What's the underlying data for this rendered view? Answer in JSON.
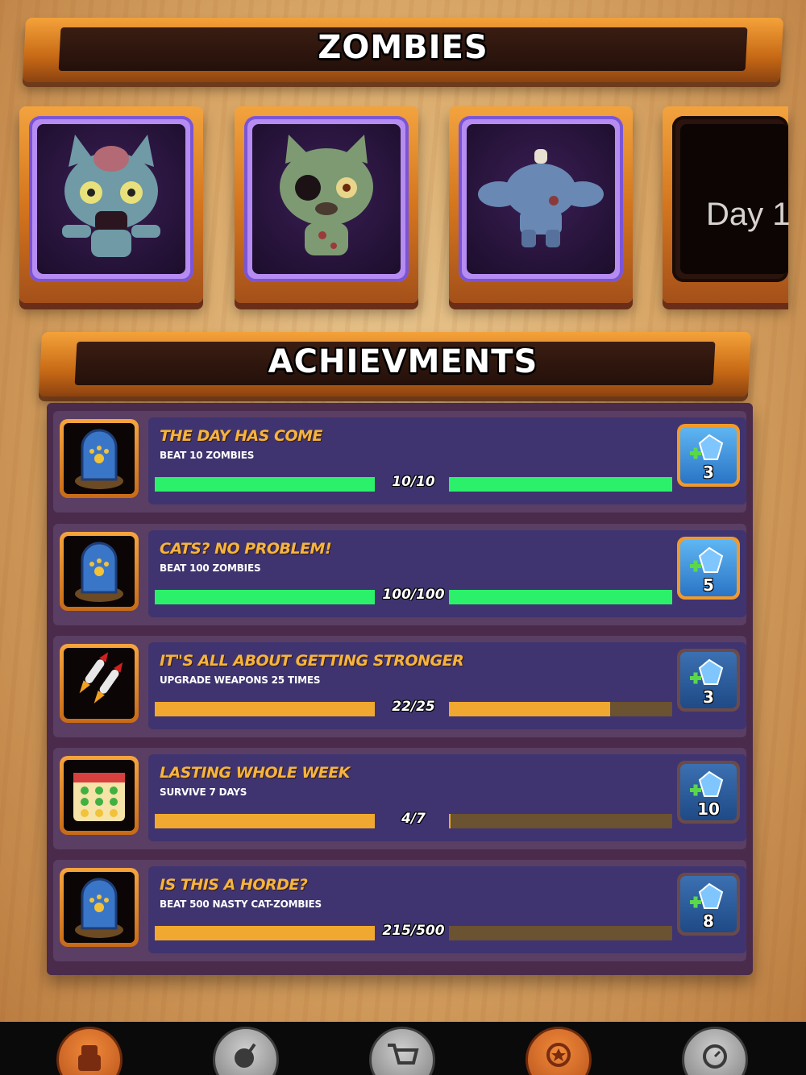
{
  "zombies_section": {
    "title": "ZOMBIES",
    "cards": [
      {
        "name": "zombie cat brain",
        "locked": false
      },
      {
        "name": "zombie cat one-eye",
        "locked": false
      },
      {
        "name": "zombie headless body",
        "locked": false
      },
      {
        "name": "locked card",
        "locked": true,
        "label": "Day 1"
      }
    ]
  },
  "achievements_section": {
    "title": "ACHIEVMENTS",
    "items": [
      {
        "title": "THE DAY HAS COME",
        "subtitle": "BEAT 10 ZOMBIES",
        "progress_text": "10/10",
        "progress": 1.0,
        "complete": true,
        "reward": "3",
        "icon": "tombstone-paw-icon"
      },
      {
        "title": "CATS? NO PROBLEM!",
        "subtitle": "BEAT 100 ZOMBIES",
        "progress_text": "100/100",
        "progress": 1.0,
        "complete": true,
        "reward": "5",
        "icon": "tombstone-paw-icon"
      },
      {
        "title": "IT\"S ALL ABOUT GETTING STRONGER",
        "subtitle": "UPGRADE WEAPONS 25 TIMES",
        "progress_text": "22/25",
        "progress": 0.88,
        "complete": false,
        "reward": "3",
        "icon": "rockets-icon"
      },
      {
        "title": "LASTING WHOLE WEEK",
        "subtitle": "SURVIVE 7 DAYS",
        "progress_text": "4/7",
        "progress": 0.571,
        "complete": false,
        "reward": "10",
        "icon": "calendar-icon"
      },
      {
        "title": "IS THIS A HORDE?",
        "subtitle": "BEAT 500 NASTY CAT-ZOMBIES",
        "progress_text": "215/500",
        "progress": 0.43,
        "complete": false,
        "reward": "8",
        "icon": "tombstone-paw-icon"
      }
    ]
  },
  "bottom_nav": {
    "items": [
      {
        "icon": "character-icon",
        "active": true
      },
      {
        "icon": "bomb-icon",
        "active": false
      },
      {
        "icon": "shop-cart-icon",
        "active": false
      },
      {
        "icon": "achievement-medal-icon",
        "active": true
      },
      {
        "icon": "stopwatch-icon",
        "active": false
      }
    ]
  },
  "colors": {
    "progress_complete": "#2bf069",
    "progress_incomplete": "#f0a830",
    "title_text": "#f5b43e",
    "row_bg": "#3f3470"
  }
}
